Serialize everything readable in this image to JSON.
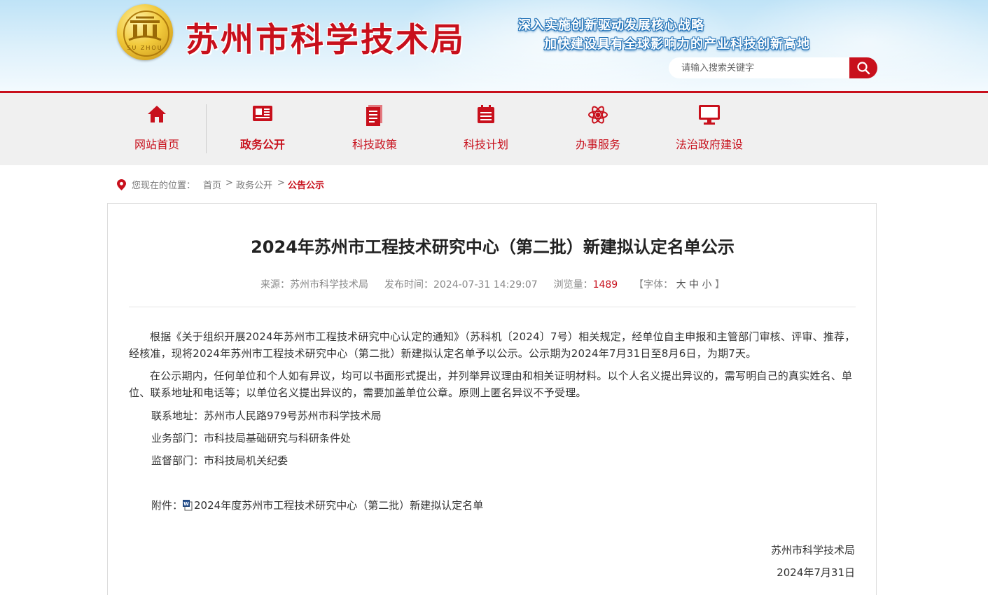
{
  "header": {
    "site_name": "苏州市科学技术局",
    "logo_text": "SU ZHOU",
    "slogan_line1": "深入实施创新驱动发展核心战略",
    "slogan_line2": "加快建设具有全球影响力的产业科技创新高地",
    "search_placeholder": "请输入搜索关键字",
    "search_icon": "search-icon"
  },
  "nav": {
    "items": [
      {
        "label": "网站首页",
        "icon": "home-icon"
      },
      {
        "label": "政务公开",
        "icon": "news-icon",
        "active": true
      },
      {
        "label": "科技政策",
        "icon": "document-icon"
      },
      {
        "label": "科技计划",
        "icon": "calendar-icon"
      },
      {
        "label": "办事服务",
        "icon": "atom-icon"
      },
      {
        "label": "法治政府建设",
        "icon": "monitor-icon"
      }
    ]
  },
  "breadcrumb": {
    "prefix": "您现在的位置：",
    "items": [
      "首页",
      "政务公开",
      "公告公示"
    ],
    "separator": ">"
  },
  "article": {
    "title": "2024年苏州市工程技术研究中心（第二批）新建拟认定名单公示",
    "source_label": "来源：",
    "source": "苏州市科学技术局",
    "time_label": "发布时间：",
    "time": "2024-07-31 14:29:07",
    "views_label": "浏览量：",
    "views": "1489",
    "font_label": "【字体：",
    "font_large": "大",
    "font_medium": "中",
    "font_small": "小",
    "font_end": "】",
    "paragraphs": [
      "根据《关于组织开展2024年苏州市工程技术研究中心认定的通知》（苏科机〔2024〕7号）相关规定，经单位自主申报和主管部门审核、评审、推荐，经核准，现将2024年苏州市工程技术研究中心（第二批）新建拟认定名单予以公示。公示期为2024年7月31日至8月6日，为期7天。",
      "在公示期内，任何单位和个人如有异议，均可以书面形式提出，并列举异议理由和相关证明材料。以个人名义提出异议的，需写明自己的真实姓名、单位、联系地址和电话等；以单位名义提出异议的，需要加盖单位公章。原则上匿名异议不予受理。"
    ],
    "contact_address": "联系地址：苏州市人民路979号苏州市科学技术局",
    "business_dept": "业务部门：市科技局基础研究与科研条件处",
    "supervise_dept": "监督部门：市科技局机关纪委",
    "attachment_label": "附件：",
    "attachment_name": "2024年度苏州市工程技术研究中心（第二批）新建拟认定名单",
    "signature_org": "苏州市科学技术局",
    "signature_date": "2024年7月31日"
  },
  "colors": {
    "brand_red": "#c8101c",
    "nav_bg": "#f0f0f0",
    "banner_blue": "#bfe3f7"
  }
}
